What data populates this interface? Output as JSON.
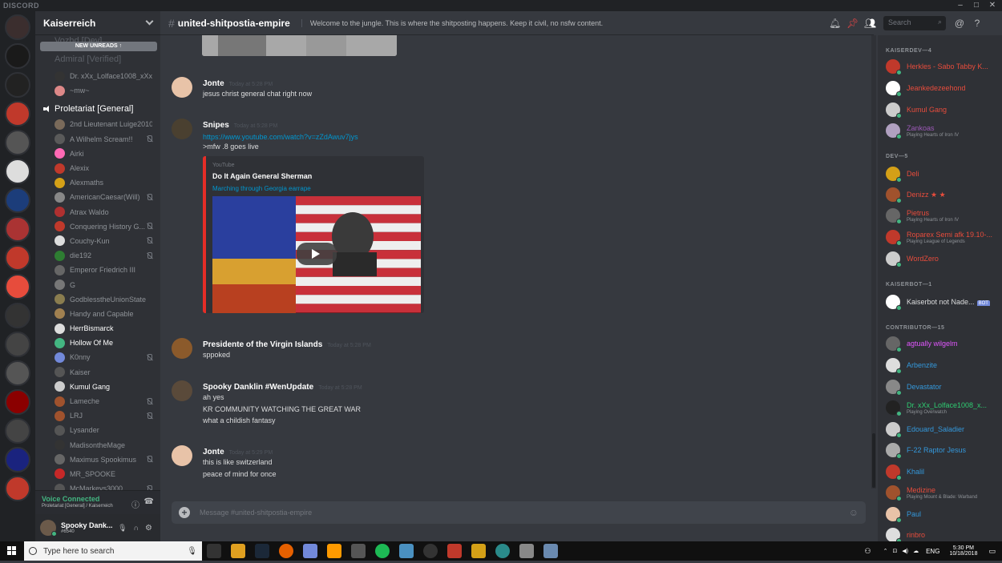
{
  "window": {
    "brand": "DISCORD"
  },
  "guild_colors": [
    "#3b2e2e",
    "#1a1a1a",
    "#222",
    "#c0392b",
    "#555",
    "#ddd",
    "#1c3d7a",
    "#a33",
    "#c0392b",
    "#e74c3c",
    "#333",
    "#444",
    "#555",
    "#8b0000",
    "#444",
    "#1a237e",
    "#c0392b"
  ],
  "server": {
    "name": "Kaiserreich",
    "new_unreads": "NEW UNREADS ↑",
    "ghost_top": "Vozhd [Dev]",
    "ghost_channel": "Admiral [Verified]",
    "ghost_users": [
      "Dr. xXx_Lolface1008_xXx",
      "~mw~"
    ],
    "voice_channel": "Proletariat [General]",
    "voice_users": [
      {
        "name": "2nd Lieutenant Luige2010",
        "bright": false,
        "muted": false,
        "color": "#7a6a5a"
      },
      {
        "name": "A Wilhelm Scream!!",
        "bright": false,
        "muted": true,
        "color": "#5a5a5a"
      },
      {
        "name": "Airki",
        "bright": false,
        "muted": false,
        "color": "#ff69b4"
      },
      {
        "name": "Alexix",
        "bright": false,
        "muted": false,
        "color": "#c0392b"
      },
      {
        "name": "Alexmaths",
        "bright": false,
        "muted": false,
        "color": "#d4a017"
      },
      {
        "name": "AmericanCaesar(Will)",
        "bright": false,
        "muted": true,
        "color": "#888"
      },
      {
        "name": "Atrax Waldo",
        "bright": false,
        "muted": false,
        "color": "#b03030"
      },
      {
        "name": "Conquering History G...",
        "bright": false,
        "muted": true,
        "color": "#c0392b"
      },
      {
        "name": "Couchy-Kun",
        "bright": false,
        "muted": true,
        "color": "#ddd"
      },
      {
        "name": "die192",
        "bright": false,
        "muted": true,
        "color": "#2e7d32"
      },
      {
        "name": "Emperor Friedrich III",
        "bright": false,
        "muted": false,
        "color": "#666"
      },
      {
        "name": "G",
        "bright": false,
        "muted": false,
        "color": "#777"
      },
      {
        "name": "GodblesstheUnionState",
        "bright": false,
        "muted": false,
        "color": "#8a7d4f"
      },
      {
        "name": "Handy and Capable",
        "bright": false,
        "muted": false,
        "color": "#a08050"
      },
      {
        "name": "HerrBismarck",
        "bright": true,
        "muted": false,
        "color": "#ddd"
      },
      {
        "name": "Hollow Of Me",
        "bright": true,
        "muted": false,
        "color": "#43b581"
      },
      {
        "name": "K0nny",
        "bright": false,
        "muted": true,
        "color": "#7289da"
      },
      {
        "name": "Kaiser",
        "bright": false,
        "muted": false,
        "color": "#555"
      },
      {
        "name": "Kumul Gang",
        "bright": true,
        "muted": false,
        "color": "#ccc"
      },
      {
        "name": "Lameche",
        "bright": false,
        "muted": true,
        "color": "#a0522d"
      },
      {
        "name": "LRJ",
        "bright": false,
        "muted": true,
        "color": "#a0522d"
      },
      {
        "name": "Lysander",
        "bright": false,
        "muted": false,
        "color": "#555"
      },
      {
        "name": "MadisontheMage",
        "bright": false,
        "muted": false,
        "color": "#333"
      },
      {
        "name": "Maximus Spookimus",
        "bright": false,
        "muted": true,
        "color": "#666"
      },
      {
        "name": "MR_SPOOKE",
        "bright": false,
        "muted": false,
        "color": "#c62828"
      },
      {
        "name": "McMarkeys3000",
        "bright": false,
        "muted": true,
        "color": "#555"
      }
    ],
    "voice_status": "Voice Connected",
    "voice_location": "Proletariat [General] / Kaiserreich",
    "user_name": "Spooky Dank...",
    "user_tag": "#6540"
  },
  "channel": {
    "name": "united-shitpostia-empire",
    "topic": "Welcome to the jungle. This is where the shitposting happens. Keep it civil, no nsfw content.",
    "search_placeholder": "Search",
    "composer_placeholder": "Message #united-shitpostia-empire"
  },
  "messages": [
    {
      "author": "Jonte",
      "time": "Today at 5:28 PM",
      "lines": [
        "jesus christ general chat right now"
      ],
      "color": "#e8c3a8"
    },
    {
      "author": "Snipes",
      "time": "Today at 5:28 PM",
      "link": "https://www.youtube.com/watch?v=zZdAwuv7jys",
      "lines": [
        ">mfw .8 goes live"
      ],
      "color": "#4a4030"
    },
    {
      "author": "Presidente of the Virgin Islands",
      "time": "Today at 5:28 PM",
      "lines": [
        "sppoked"
      ],
      "color": "#8b5a2b"
    },
    {
      "author": "Spooky Danklin #WenUpdate",
      "time": "Today at 5:28 PM",
      "lines": [
        "ah yes",
        "KR COMMUNITY WATCHING THE GREAT WAR",
        "what a childish fantasy"
      ],
      "color": "#5a4a3a"
    },
    {
      "author": "Jonte",
      "time": "Today at 5:29 PM",
      "lines": [
        "this is like switzerland",
        "peace of mind for once"
      ],
      "color": "#e8c3a8"
    }
  ],
  "embed": {
    "provider": "YouTube",
    "title": "Do It Again General Sherman",
    "description": "Marching through Georgia earrape",
    "accent": "#e52d27"
  },
  "members": {
    "categories": [
      "KAISERDEV—4",
      "DEV—5",
      "KAISERBOT—1",
      "CONTRIBUTOR—15"
    ],
    "list": [
      {
        "name": "Herkles - Sabo Tabby K...",
        "color": "#e74c3c",
        "activity": "",
        "avatar": "#c0392b"
      },
      {
        "name": "Jeankedezeehond",
        "color": "#e74c3c",
        "activity": "",
        "avatar": "#fff"
      },
      {
        "name": "Kumul Gang",
        "color": "#e74c3c",
        "activity": "",
        "avatar": "#ccc"
      },
      {
        "name": "Zankoas",
        "color": "#9b59b6",
        "activity": "Playing Hearts of Iron IV",
        "avatar": "#b0a0c0"
      },
      {
        "name": "Deli",
        "color": "#e74c3c",
        "activity": "",
        "avatar": "#d4a017"
      },
      {
        "name": "Denizz ★ ★",
        "color": "#e74c3c",
        "activity": "",
        "avatar": "#a0522d"
      },
      {
        "name": "Pietrus",
        "color": "#e74c3c",
        "activity": "Playing Hearts of Iron IV",
        "avatar": "#666"
      },
      {
        "name": "Roparex Semi afk 19.10-...",
        "color": "#e74c3c",
        "activity": "Playing League of Legends",
        "avatar": "#c0392b"
      },
      {
        "name": "WordZero",
        "color": "#e74c3c",
        "activity": "",
        "avatar": "#ccc"
      },
      {
        "name": "Kaiserbot not Nade...",
        "color": "#dcddde",
        "activity": "",
        "avatar": "#fff",
        "bot": "BOT"
      },
      {
        "name": "agtually wilgelm",
        "color": "#e056fd",
        "activity": "",
        "avatar": "#666"
      },
      {
        "name": "Arbenzite",
        "color": "#3498db",
        "activity": "",
        "avatar": "#ddd"
      },
      {
        "name": "Devastator",
        "color": "#3498db",
        "activity": "",
        "avatar": "#888"
      },
      {
        "name": "Dr. xXx_Lolface1008_x...",
        "color": "#2ecc71",
        "activity": "Playing Overwatch",
        "avatar": "#222"
      },
      {
        "name": "Edouard_Saladier",
        "color": "#3498db",
        "activity": "",
        "avatar": "#ccc"
      },
      {
        "name": "F-22 Raptor Jesus",
        "color": "#3498db",
        "activity": "",
        "avatar": "#aaa"
      },
      {
        "name": "Khalil",
        "color": "#3498db",
        "activity": "",
        "avatar": "#c0392b"
      },
      {
        "name": "Medizine",
        "color": "#e74c3c",
        "activity": "Playing Mount & Blade: Warband",
        "avatar": "#a0522d"
      },
      {
        "name": "Paul",
        "color": "#3498db",
        "activity": "",
        "avatar": "#e8c3a8"
      },
      {
        "name": "rinbro",
        "color": "#e74c3c",
        "activity": "",
        "avatar": "#ddd"
      }
    ]
  },
  "taskbar": {
    "search_placeholder": "Type here to search",
    "language": "ENG",
    "time": "5:30 PM",
    "date": "10/18/2018"
  }
}
